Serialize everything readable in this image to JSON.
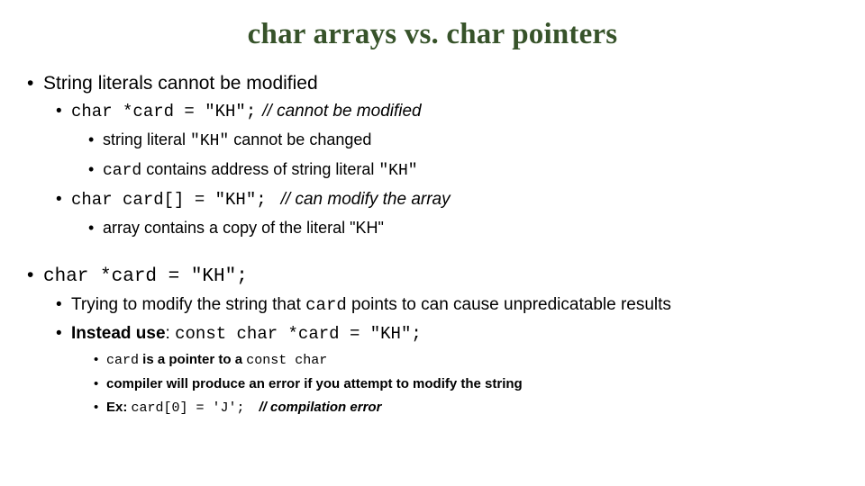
{
  "title": "char arrays vs. char pointers",
  "theme": {
    "title_color": "#37532a",
    "body_color": "#000000",
    "background": "#ffffff"
  },
  "bullet_glyph": "•",
  "block1": {
    "heading": "String literals cannot be modified",
    "line1": {
      "code": "char *card = \"KH\";",
      "comment": "// cannot be modified"
    },
    "line2": {
      "text_a": "string literal ",
      "code": "\"KH\"",
      "text_b": "  cannot be changed"
    },
    "line3": {
      "code_a": "card",
      "text_a": " contains address of string literal ",
      "code_b": "\"KH\""
    },
    "line4": {
      "code": "char card[] = \"KH\";",
      "comment": "// can modify the array"
    },
    "line5": {
      "text": "array contains a copy of the literal \"KH\""
    }
  },
  "block2": {
    "heading_code": "char *card = \"KH\";",
    "line1": {
      "text_a": "Trying to modify the string that ",
      "code": "card",
      "text_b": " points to can cause unpredicatable results"
    },
    "line2": {
      "text_a": "Instead use",
      "text_b": ": ",
      "code": "const char *card = \"KH\";"
    },
    "sub1": {
      "code_a": "card",
      "text_a": " is a pointer to a ",
      "code_b": "const char"
    },
    "sub2": {
      "text": "compiler will produce an error if you attempt to modify the string"
    },
    "sub3": {
      "text_a": "Ex: ",
      "code": "card[0] = 'J';",
      "comment": "// compilation error"
    }
  }
}
